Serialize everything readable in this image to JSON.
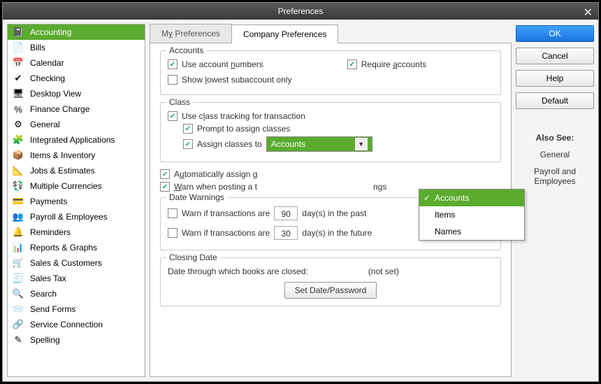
{
  "title": "Preferences",
  "sidebar": {
    "items": [
      {
        "label": "Accounting",
        "icon": "📓"
      },
      {
        "label": "Bills",
        "icon": "📄"
      },
      {
        "label": "Calendar",
        "icon": "📅"
      },
      {
        "label": "Checking",
        "icon": "✔"
      },
      {
        "label": "Desktop View",
        "icon": "🖥"
      },
      {
        "label": "Finance Charge",
        "icon": "%"
      },
      {
        "label": "General",
        "icon": "⚙"
      },
      {
        "label": "Integrated Applications",
        "icon": "🧩"
      },
      {
        "label": "Items & Inventory",
        "icon": "📦"
      },
      {
        "label": "Jobs & Estimates",
        "icon": "📐"
      },
      {
        "label": "Multiple Currencies",
        "icon": "💱"
      },
      {
        "label": "Payments",
        "icon": "💳"
      },
      {
        "label": "Payroll & Employees",
        "icon": "👥"
      },
      {
        "label": "Reminders",
        "icon": "🔔"
      },
      {
        "label": "Reports & Graphs",
        "icon": "📊"
      },
      {
        "label": "Sales & Customers",
        "icon": "🛒"
      },
      {
        "label": "Sales Tax",
        "icon": "🧾"
      },
      {
        "label": "Search",
        "icon": "🔍"
      },
      {
        "label": "Send Forms",
        "icon": "📨"
      },
      {
        "label": "Service Connection",
        "icon": "🔗"
      },
      {
        "label": "Spelling",
        "icon": "✎"
      }
    ],
    "activeIndex": 0
  },
  "tabs": {
    "my": {
      "pre": "M",
      "ul": "y",
      "post": " Preferences"
    },
    "company": "Company Preferences",
    "activeIndex": 1
  },
  "accounts": {
    "legend": "Accounts",
    "useNumbers": {
      "pre": "Use account ",
      "ul": "n",
      "post": "umbers",
      "checked": true
    },
    "require": {
      "pre": "Require ",
      "ul": "a",
      "post": "ccounts",
      "checked": true
    },
    "showLowest": {
      "pre": "Show ",
      "ul": "l",
      "post": "owest subaccount only",
      "checked": false
    }
  },
  "class": {
    "legend": "Class",
    "useTracking": {
      "pre": "Use c",
      "ul": "l",
      "post": "ass tracking for transaction",
      "checked": true
    },
    "prompt": {
      "label": "Prompt to assign classes",
      "checked": true
    },
    "assign": {
      "label": "Assign classes to",
      "checked": true
    },
    "combo": {
      "value": "Accounts",
      "options": [
        "Accounts",
        "Items",
        "Names"
      ],
      "selectedIndex": 0
    }
  },
  "auto": {
    "pre": "A",
    "ul": "u",
    "post": "tomatically assign g",
    "checked": true
  },
  "warn": {
    "pre": "",
    "ul": "W",
    "post": "arn when posting a t",
    "trail": "ngs",
    "checked": true
  },
  "dateWarnings": {
    "legend": "Date Warnings",
    "past": {
      "label": "Warn if transactions are",
      "value": "90",
      "suffix": "day(s) in the past",
      "checked": false
    },
    "future": {
      "label": "Warn if transactions are",
      "value": "30",
      "suffix": "day(s) in the future",
      "checked": false
    }
  },
  "closing": {
    "legend": "Closing Date",
    "text": "Date through which books are closed:",
    "notset": "(not set)",
    "btn": "Set Date/Password"
  },
  "buttons": {
    "ok": "OK",
    "cancel": "Cancel",
    "help": {
      "pre": "",
      "ul": "H",
      "post": "elp"
    },
    "default": {
      "pre": "",
      "ul": "D",
      "post": "efault"
    }
  },
  "alsosee": {
    "hdr": "Also See:",
    "links": [
      "General",
      "Payroll and Employees"
    ]
  }
}
